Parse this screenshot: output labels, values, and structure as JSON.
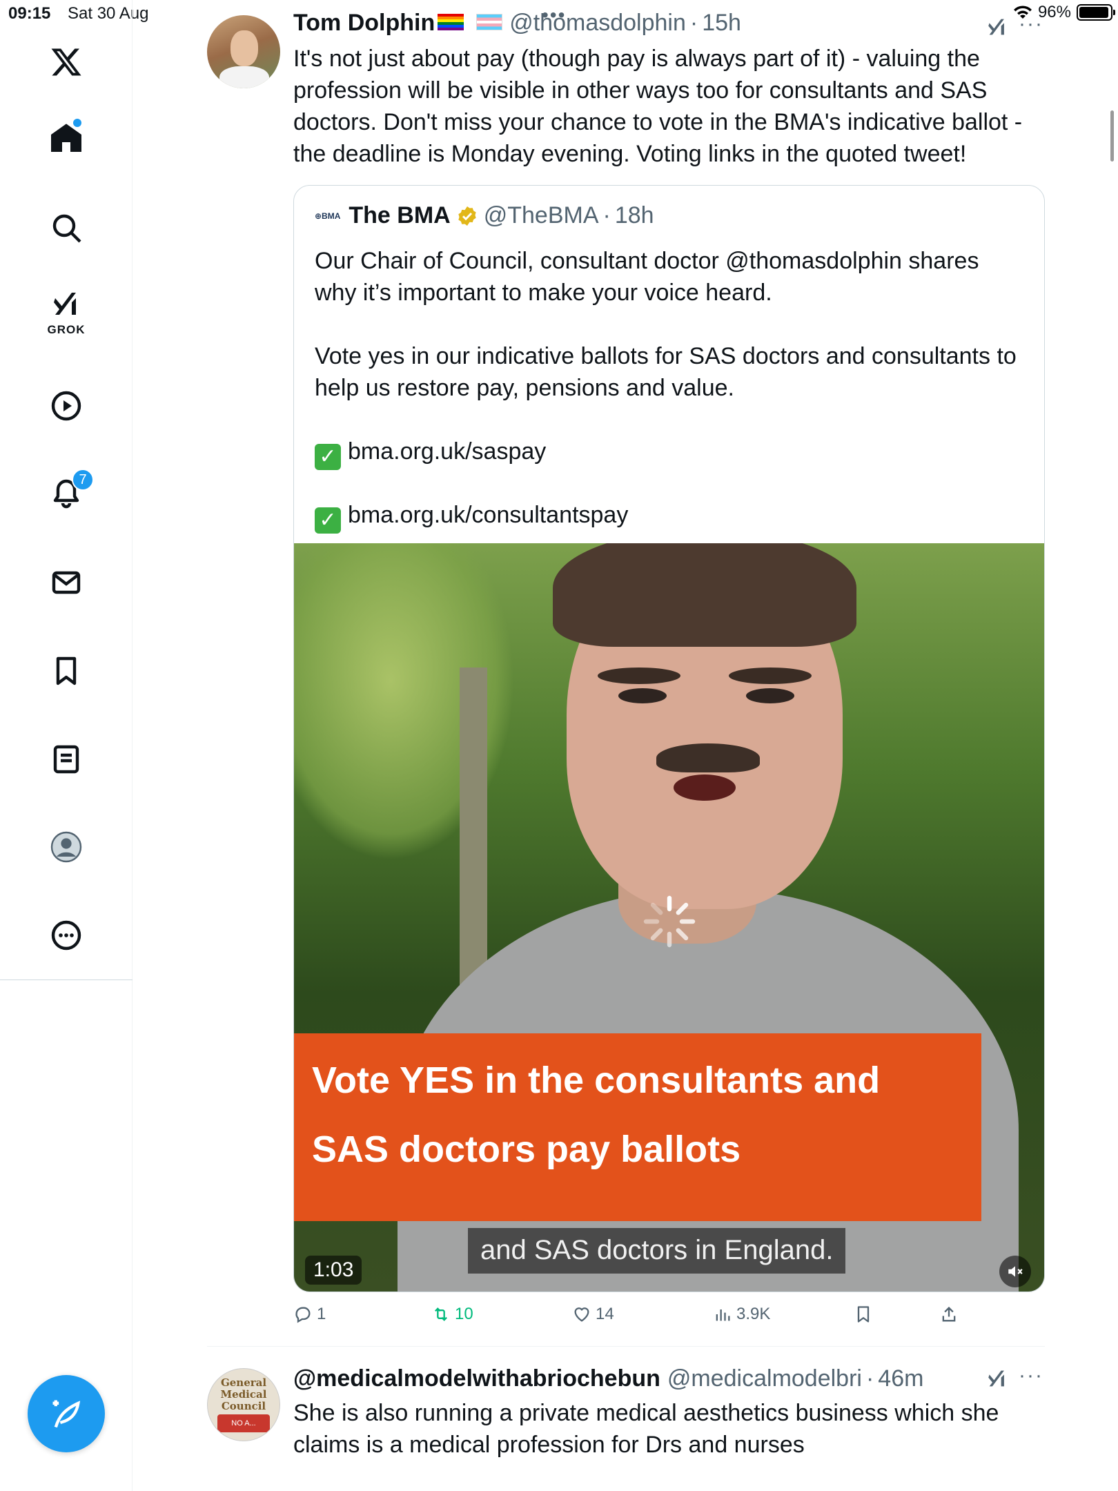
{
  "status_bar": {
    "time": "09:15",
    "date": "Sat 30 Aug",
    "battery": "96%",
    "battery_level": 0.96
  },
  "sidebar": {
    "items": [
      {
        "name": "x-logo-icon"
      },
      {
        "name": "home-icon",
        "has_dot": true
      },
      {
        "name": "search-icon"
      },
      {
        "name": "grok-icon",
        "label": "GROK"
      },
      {
        "name": "video-icon"
      },
      {
        "name": "notifications-icon",
        "badge": "7"
      },
      {
        "name": "messages-icon"
      },
      {
        "name": "bookmarks-icon"
      },
      {
        "name": "lists-icon"
      },
      {
        "name": "profile-icon"
      },
      {
        "name": "more-icon"
      }
    ],
    "compose_icon": "compose-feather-icon"
  },
  "tweet": {
    "author": "Tom Dolphin",
    "handle": "@thomasdolphin",
    "separator": "·",
    "time": "15h",
    "text": "It's not just about pay (though pay is always part of it) - valuing the profession will be visible in other ways too for consultants and SAS doctors. Don't miss your chance to vote in the BMA's indicative ballot - the deadline is Monday evening. Voting links in the quoted tweet!",
    "quote": {
      "logo": "⊕BMA",
      "author": "The BMA",
      "handle": "@TheBMA",
      "separator": "·",
      "time": "18h",
      "paragraph_1": "Our Chair of Council, consultant doctor @thomasdolphin shares why it’s important to make your voice heard.",
      "paragraph_2": "Vote yes in our indicative ballots for SAS doctors and consultants to help us restore pay, pensions and value.",
      "link_1": "bma.org.uk/saspay",
      "link_2": "bma.org.uk/consultantspay",
      "video": {
        "banner_line_1": "Vote YES in the consultants and",
        "banner_line_2": "SAS doctors pay ballots",
        "caption": "and SAS doctors in England.",
        "duration": "1:03"
      }
    },
    "actions": {
      "replies": "1",
      "retweets": "10",
      "likes": "14",
      "views": "3.9K"
    },
    "colors": {
      "retweet": "#00ba7c",
      "accent": "#1d9bf0"
    }
  },
  "next_tweet": {
    "author": "@medicalmodelwithabriochebun",
    "handle": "@medicalmodelbri",
    "separator": "·",
    "time": "46m",
    "text": "She is also running a private medical aesthetics business which she claims is a medical profession for Drs and nurses",
    "avatar_text": "General Medical Council",
    "avatar_stamp": "NO A..."
  }
}
